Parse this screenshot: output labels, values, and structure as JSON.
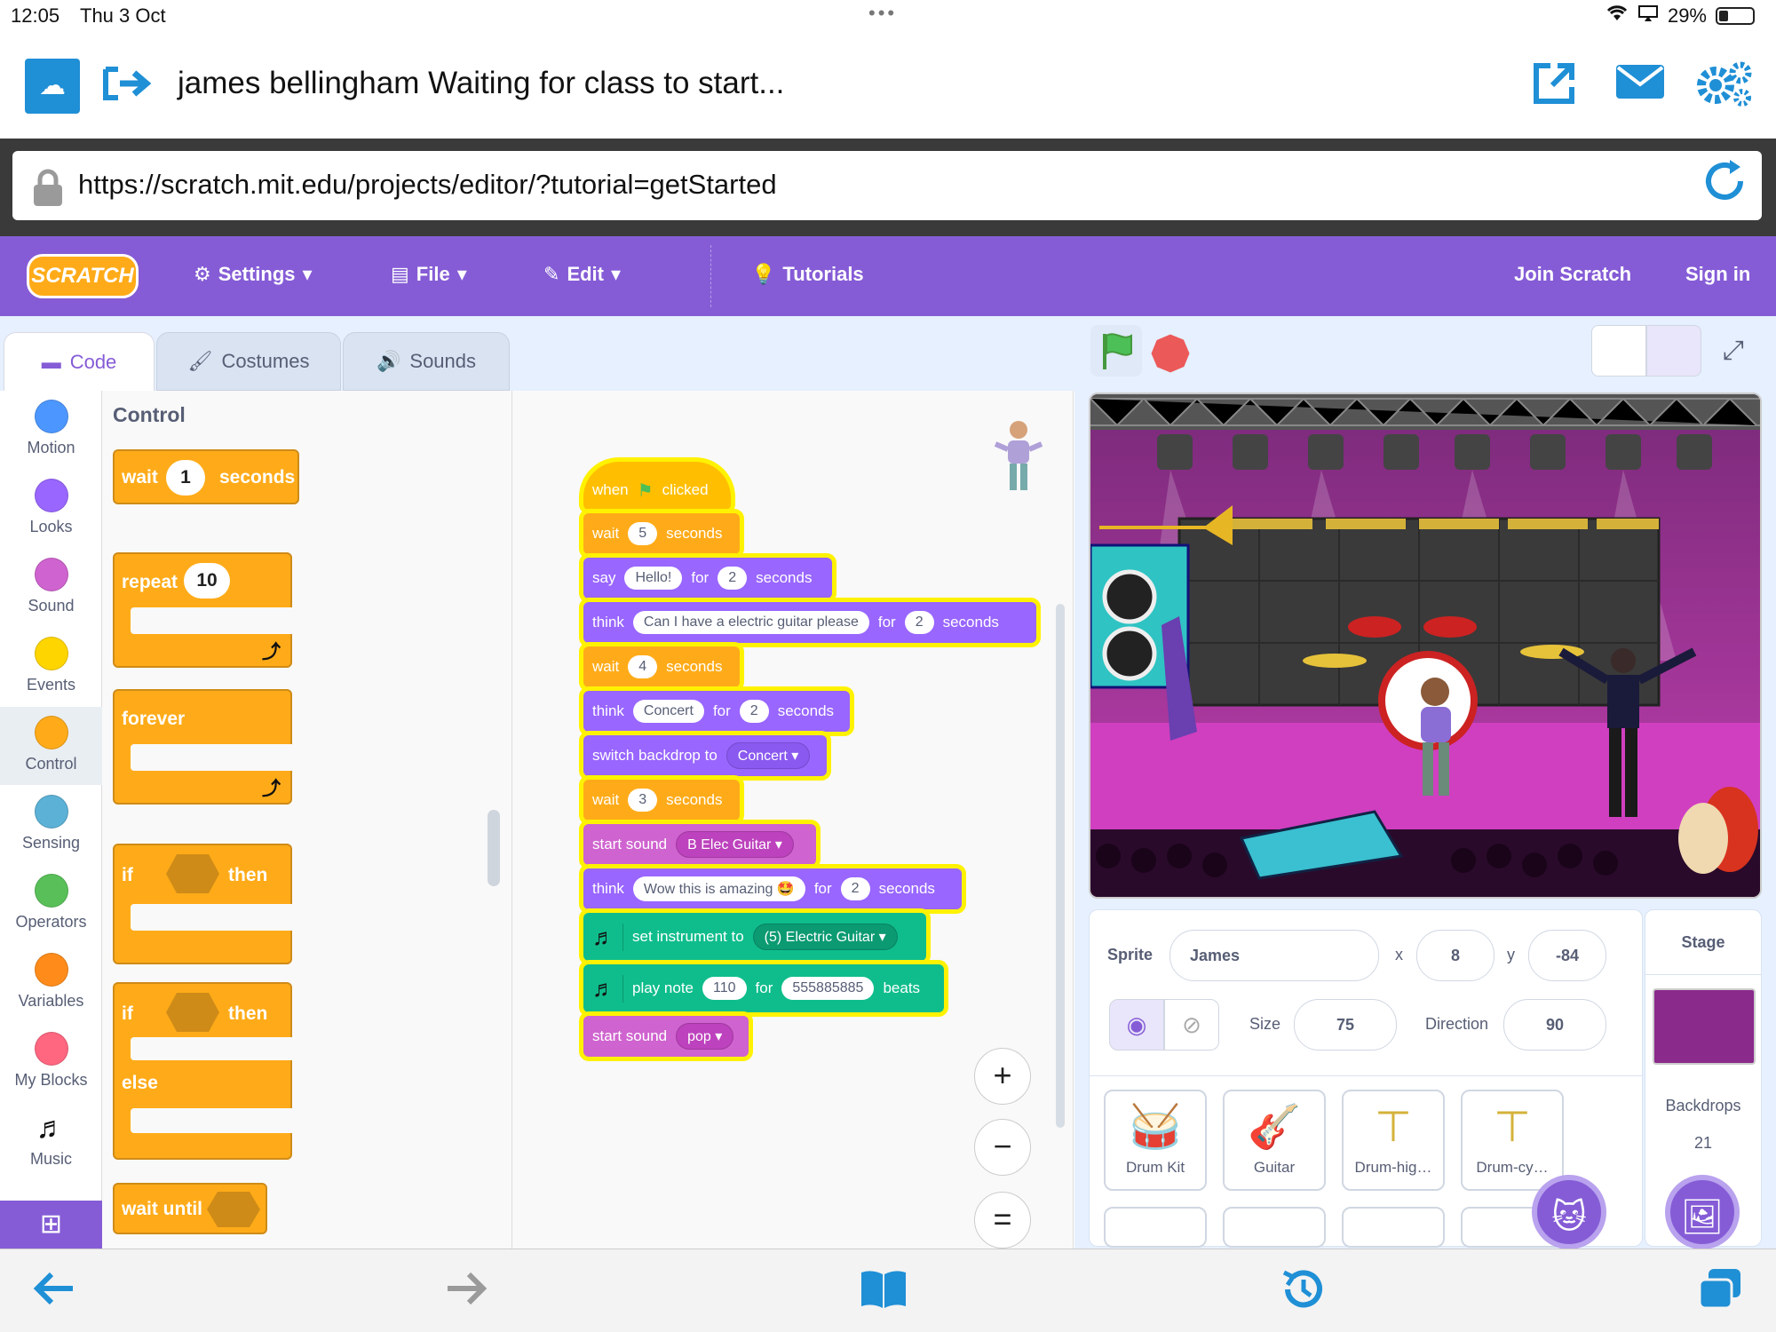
{
  "status_bar": {
    "time": "12:05",
    "date": "Thu 3 Oct",
    "battery": "29%"
  },
  "app_header": {
    "title": "james bellingham Waiting for class to start..."
  },
  "browser": {
    "url": "https://scratch.mit.edu/projects/editor/?tutorial=getStarted"
  },
  "menubar": {
    "logo": "SCRATCH",
    "settings": "Settings",
    "file": "File",
    "edit": "Edit",
    "tutorials": "Tutorials",
    "join": "Join Scratch",
    "signin": "Sign in"
  },
  "tabs": {
    "code": "Code",
    "costumes": "Costumes",
    "sounds": "Sounds"
  },
  "categories": [
    {
      "label": "Motion",
      "color": "#4c97ff"
    },
    {
      "label": "Looks",
      "color": "#9966ff"
    },
    {
      "label": "Sound",
      "color": "#cf63cf"
    },
    {
      "label": "Events",
      "color": "#ffd500"
    },
    {
      "label": "Control",
      "color": "#ffab19"
    },
    {
      "label": "Sensing",
      "color": "#5cb1d6"
    },
    {
      "label": "Operators",
      "color": "#59c059"
    },
    {
      "label": "Variables",
      "color": "#ff8c1a"
    },
    {
      "label": "My Blocks",
      "color": "#ff6680"
    },
    {
      "label": "Music",
      "color": "#0fbd8c"
    }
  ],
  "palette": {
    "title": "Control",
    "wait": {
      "label": "wait",
      "value": "1",
      "unit": "seconds"
    },
    "repeat": {
      "label": "repeat",
      "value": "10"
    },
    "forever": "forever",
    "if_then": {
      "if": "if",
      "then": "then"
    },
    "if_else": {
      "if": "if",
      "then": "then",
      "else": "else"
    },
    "wait_until": "wait until"
  },
  "script": {
    "hat": {
      "when": "when",
      "clicked": "clicked"
    },
    "b1": {
      "label": "wait",
      "value": "5",
      "unit": "seconds"
    },
    "b2": {
      "label": "say",
      "text": "Hello!",
      "for": "for",
      "value": "2",
      "unit": "seconds"
    },
    "b3": {
      "label": "think",
      "text": "Can I have a electric guitar please",
      "for": "for",
      "value": "2",
      "unit": "seconds"
    },
    "b4": {
      "label": "wait",
      "value": "4",
      "unit": "seconds"
    },
    "b5": {
      "label": "think",
      "text": "Concert",
      "for": "for",
      "value": "2",
      "unit": "seconds"
    },
    "b6": {
      "label": "switch backdrop to",
      "value": "Concert"
    },
    "b7": {
      "label": "wait",
      "value": "3",
      "unit": "seconds"
    },
    "b8": {
      "label": "start sound",
      "value": "B Elec Guitar"
    },
    "b9": {
      "label": "think",
      "text": "Wow this is amazing 🤩",
      "for": "for",
      "value": "2",
      "unit": "seconds"
    },
    "b10": {
      "label": "set instrument to",
      "value": "(5) Electric Guitar"
    },
    "b11": {
      "label": "play note",
      "note": "110",
      "for": "for",
      "beats": "555885885",
      "unit": "beats"
    },
    "b12": {
      "label": "start sound",
      "value": "pop"
    }
  },
  "zoom": {
    "in": "+",
    "out": "−",
    "reset": "="
  },
  "sprite_info": {
    "sprite_label": "Sprite",
    "sprite_name": "James",
    "x_label": "x",
    "x": "8",
    "y_label": "y",
    "y": "-84",
    "size_label": "Size",
    "size": "75",
    "direction_label": "Direction",
    "direction": "90"
  },
  "sprites": [
    "Drum Kit",
    "Guitar",
    "Drum-hig…",
    "Drum-cy…"
  ],
  "stage_panel": {
    "title": "Stage",
    "backdrops_label": "Backdrops",
    "backdrops_count": "21"
  }
}
